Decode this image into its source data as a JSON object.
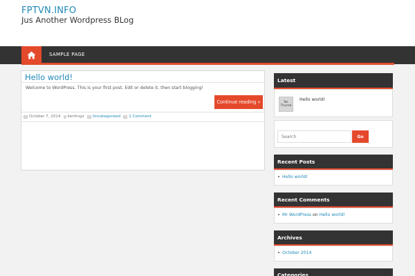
{
  "site": {
    "title": "FPTVN.INFO",
    "tagline": "Jus Another Wordpress BLog"
  },
  "nav": {
    "home_icon": "home-icon",
    "items": [
      {
        "label": "SAMPLE PAGE"
      }
    ]
  },
  "post": {
    "title": "Hello world!",
    "excerpt": "Welcome to WordPress. This is your first post. Edit or delete it, then start blogging!",
    "continue_label": "Continue reading »",
    "date": "October 7, 2014",
    "author": "keritingz",
    "category": "Uncategorized",
    "comments": "1 Comment"
  },
  "sidebar": {
    "latest": {
      "heading": "Latest",
      "thumb_line1": "No",
      "thumb_line2": "Thumb",
      "post": "Hello world!"
    },
    "search": {
      "placeholder": "Search",
      "button": "Go"
    },
    "recent_posts": {
      "heading": "Recent Posts",
      "items": [
        "Hello world!"
      ]
    },
    "recent_comments": {
      "heading": "Recent Comments",
      "author": "Mr WordPress",
      "on": "on",
      "post": "Hello world!"
    },
    "archives": {
      "heading": "Archives",
      "items": [
        "October 2014"
      ]
    },
    "categories": {
      "heading": "Categories"
    }
  },
  "colors": {
    "accent": "#e5492c",
    "link": "#1e88b8",
    "nav_bg": "#333333",
    "page_bg": "#f2f2f2"
  }
}
